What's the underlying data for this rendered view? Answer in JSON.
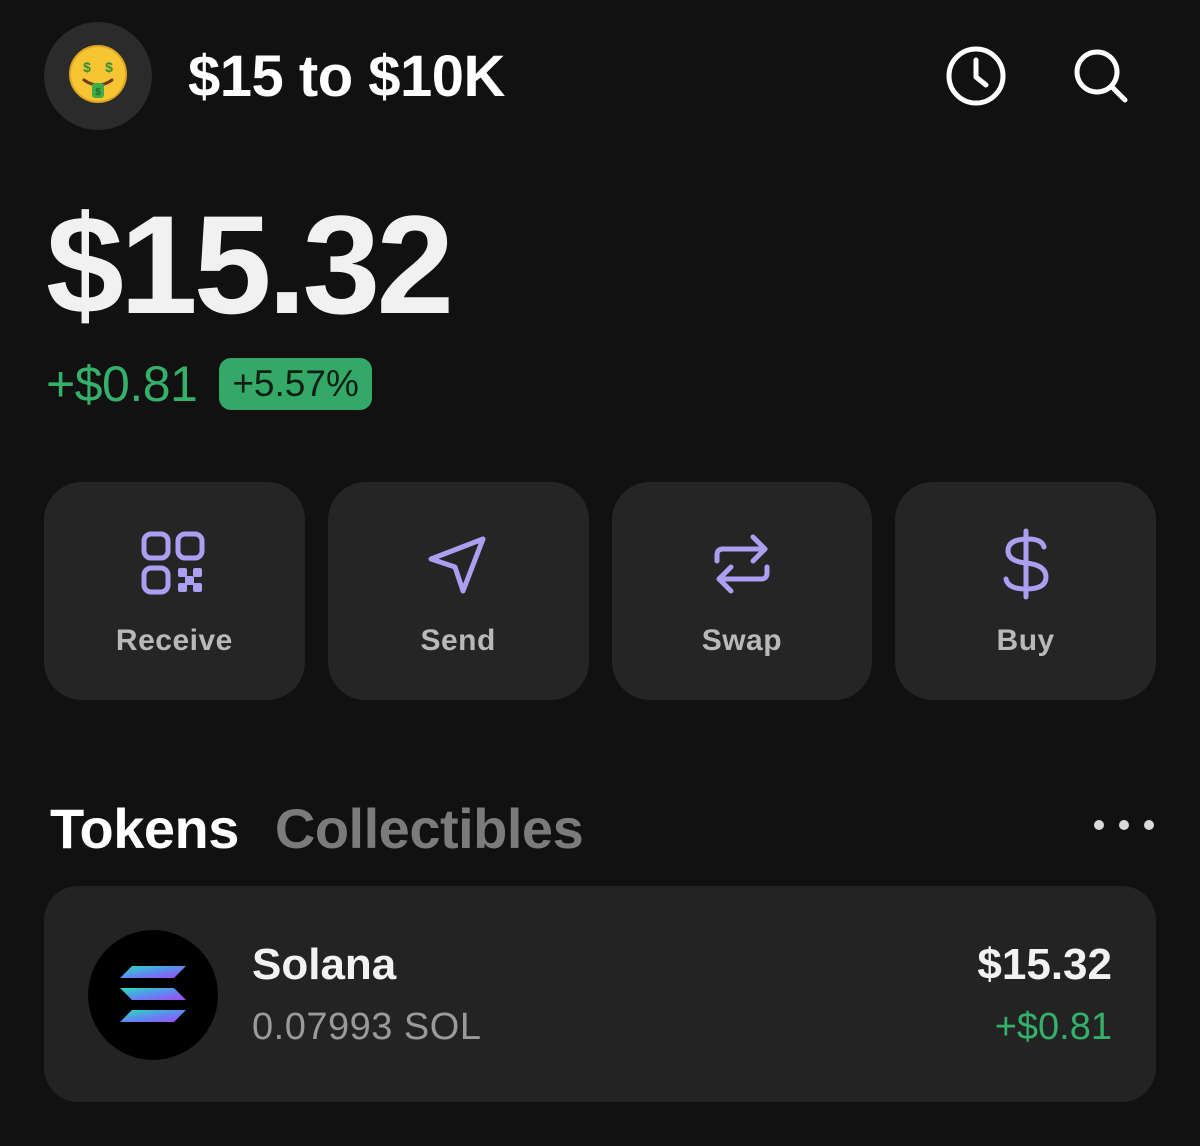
{
  "header": {
    "avatar_emoji": "🤑",
    "wallet_name": "$15 to $10K",
    "history_icon": "clock-icon",
    "search_icon": "search-icon"
  },
  "balance": {
    "total": "$15.32",
    "change_amount": "+$0.81",
    "change_percent": "+5.57%"
  },
  "actions": [
    {
      "label": "Receive",
      "icon": "qr-code-icon"
    },
    {
      "label": "Send",
      "icon": "send-icon"
    },
    {
      "label": "Swap",
      "icon": "swap-icon"
    },
    {
      "label": "Buy",
      "icon": "dollar-icon"
    }
  ],
  "tabs": {
    "active": "Tokens",
    "inactive": "Collectibles",
    "more_icon": "more-icon"
  },
  "tokens": [
    {
      "name": "Solana",
      "amount": "0.07993 SOL",
      "value": "$15.32",
      "change": "+$0.81",
      "icon": "solana-logo-icon"
    }
  ],
  "colors": {
    "background": "#111111",
    "card": "#252525",
    "accent_purple": "#ab9ff2",
    "positive_green": "#35b06a",
    "badge_green": "#34a866"
  }
}
